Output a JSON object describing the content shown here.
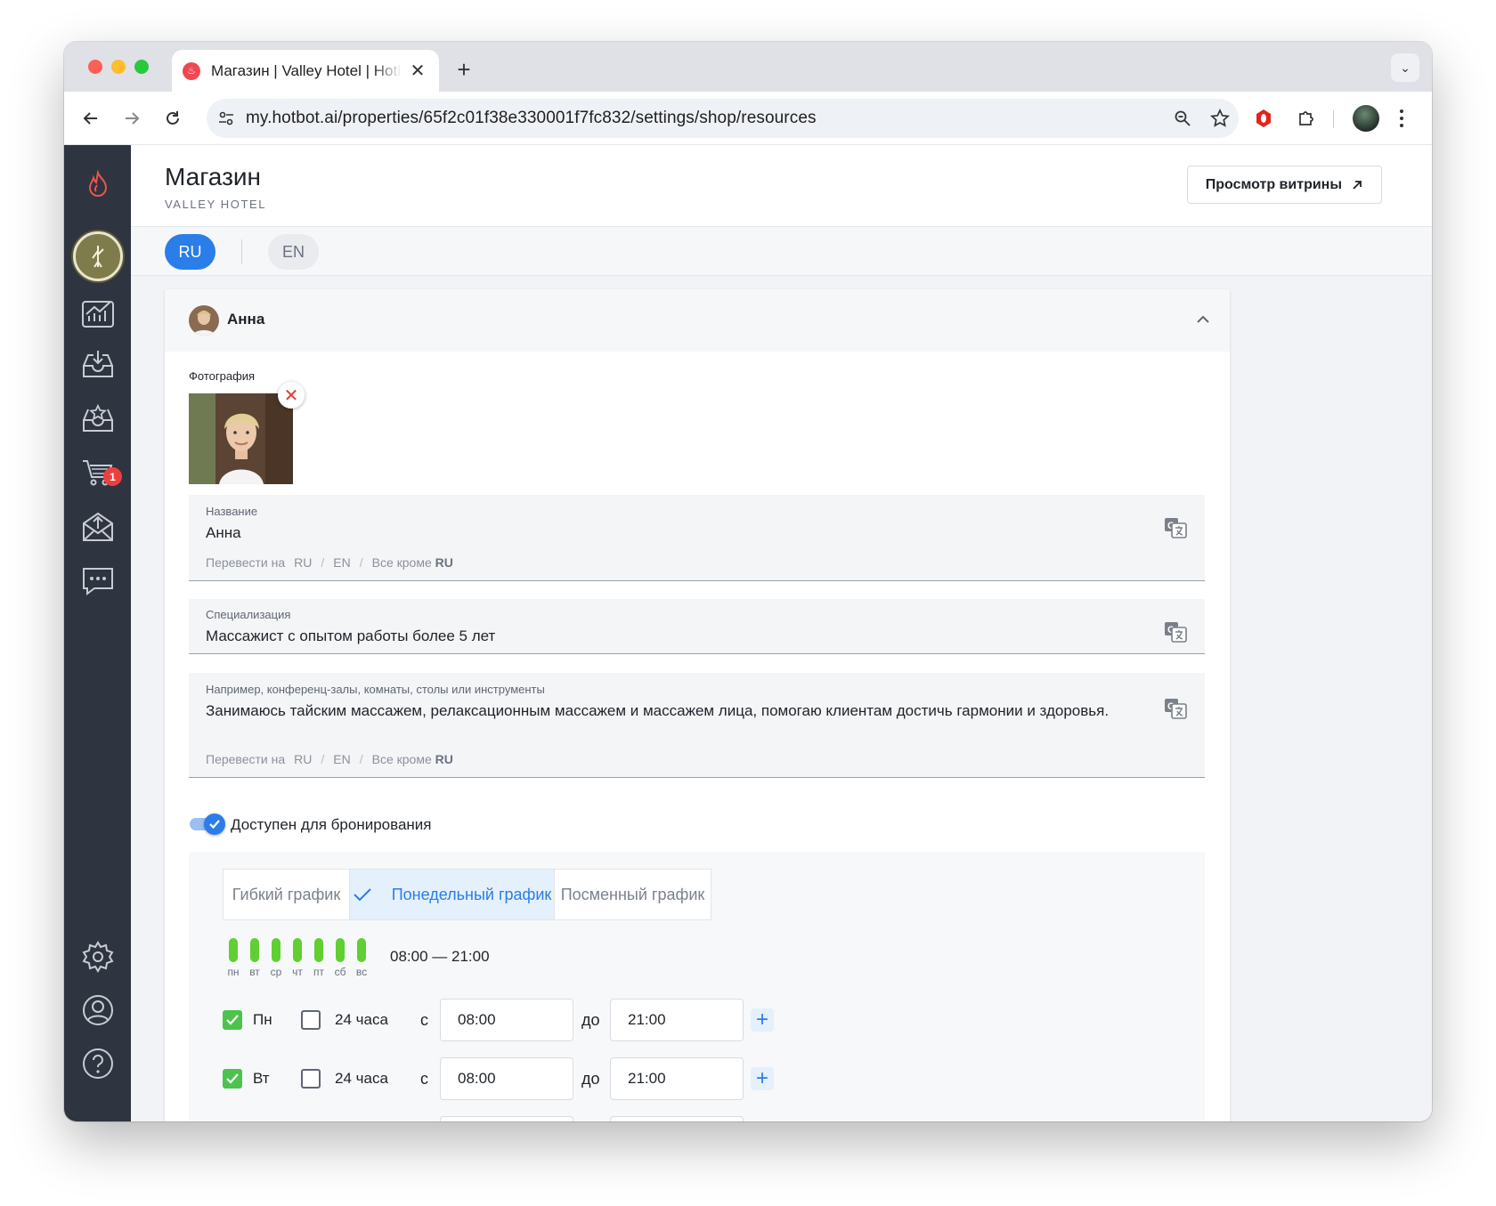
{
  "browser": {
    "tab_title": "Магазин | Valley Hotel | Hotbot",
    "url": "my.hotbot.ai/properties/65f2c01f38e330001f7fc832/settings/shop/resources"
  },
  "sidebar": {
    "cart_badge": "1",
    "items": [
      "analytics-icon",
      "inbox-icon",
      "reviews-icon",
      "cart-icon",
      "mailing-icon",
      "chat-icon",
      "settings-icon",
      "profile-icon",
      "help-icon"
    ]
  },
  "header": {
    "title": "Магазин",
    "subtitle": "VALLEY HOTEL",
    "storefront_button": "Просмотр витрины"
  },
  "languages": {
    "ru": "RU",
    "en": "EN",
    "active": "RU"
  },
  "resource": {
    "name": "Анна",
    "photo_label": "Фотография",
    "fields": {
      "name": {
        "label": "Название",
        "value": "Анна"
      },
      "specialization": {
        "label": "Специализация",
        "value": "Массажист с опытом работы более 5 лет"
      },
      "description": {
        "label": "Например, конференц-залы, комнаты, столы или инструменты",
        "value": "Занимаюсь тайским массажем, релаксационным массажем и массажем лица, помогаю клиентам достичь гармонии и здоровья."
      }
    },
    "translate": {
      "prefix": "Перевести на",
      "ru": "RU",
      "en": "EN",
      "all_except": "Все кроме",
      "all_except_lang": "RU"
    },
    "booking_toggle": {
      "label": "Доступен для бронирования",
      "on": true
    }
  },
  "schedule": {
    "tabs": [
      "Гибкий график",
      "Понедельный график",
      "Посменный график"
    ],
    "active_tab": "Понедельный график",
    "days_short": [
      "пн",
      "вт",
      "ср",
      "чт",
      "пт",
      "сб",
      "вс"
    ],
    "summary": "08:00 — 21:00",
    "allday_label": "24 часа",
    "from_label": "с",
    "to_label": "до",
    "rows": [
      {
        "day": "Пн",
        "enabled": true,
        "all_day": false,
        "from": "08:00",
        "to": "21:00"
      },
      {
        "day": "Вт",
        "enabled": true,
        "all_day": false,
        "from": "08:00",
        "to": "21:00"
      }
    ]
  },
  "colors": {
    "accent": "#2b7de9",
    "sidebar_bg": "#2e3440",
    "day_active": "#5fcf31",
    "checkbox_on": "#4cc34c",
    "remove": "#e53935"
  }
}
